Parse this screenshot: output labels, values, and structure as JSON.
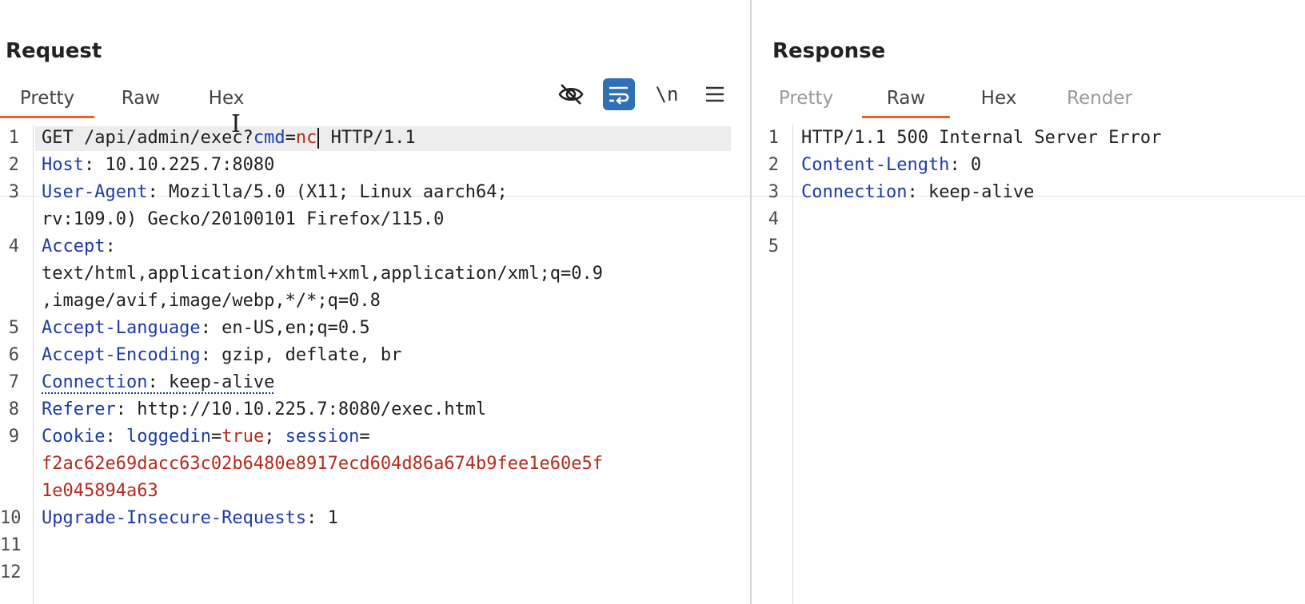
{
  "request": {
    "title": "Request",
    "tabs": [
      {
        "label": "Pretty",
        "active": true
      },
      {
        "label": "Raw",
        "active": false
      },
      {
        "label": "Hex",
        "active": false
      }
    ],
    "toolbar_icons": [
      {
        "name": "hide-nonprinting-icon"
      },
      {
        "name": "word-wrap-icon",
        "active": true
      },
      {
        "name": "newline-toggle-icon",
        "label": "\\n"
      },
      {
        "name": "menu-icon"
      }
    ],
    "line_numbers": [
      "1",
      "2",
      "3",
      "4",
      "5",
      "6",
      "7",
      "8",
      "9",
      "10",
      "11",
      "12"
    ],
    "lines": {
      "l1": {
        "method": "GET ",
        "path": "/api/admin/exec?",
        "param_name": "cmd",
        "eq": "=",
        "param_value": "nc",
        "protocol": " HTTP/1.1"
      },
      "l2": {
        "name": "Host",
        "value": ": 10.10.225.7:8080"
      },
      "l3": {
        "name": "User-Agent",
        "value": ": Mozilla/5.0 (X11; Linux aarch64;",
        "cont": "rv:109.0) Gecko/20100101 Firefox/115.0"
      },
      "l4": {
        "name": "Accept",
        "value": ":",
        "cont1": "text/html,application/xhtml+xml,application/xml;q=0.9",
        "cont2": ",image/avif,image/webp,*/*;q=0.8"
      },
      "l5": {
        "name": "Accept-Language",
        "value": ": en-US,en;q=0.5"
      },
      "l6": {
        "name": "Accept-Encoding",
        "value": ": gzip, deflate, br"
      },
      "l7": {
        "name": "Connection",
        "value": ": keep-alive"
      },
      "l8": {
        "name": "Referer",
        "value": ": http://10.10.225.7:8080/exec.html"
      },
      "l9": {
        "name": "Cookie",
        "sep": ": ",
        "c1_name": "loggedin",
        "c1_eq": "=",
        "c1_value": "true",
        "c_sep": "; ",
        "c2_name": "session",
        "c2_eq": "=",
        "c2_value1": "f2ac62e69dacc63c02b6480e8917ecd604d86a674b9fee1e60e5f",
        "c2_value2": "1e045894a63"
      },
      "l10": {
        "name": "Upgrade-Insecure-Requests",
        "value": ": 1"
      }
    }
  },
  "response": {
    "title": "Response",
    "tabs": [
      {
        "label": "Pretty",
        "active": false,
        "disabled": true
      },
      {
        "label": "Raw",
        "active": true
      },
      {
        "label": "Hex",
        "active": false
      },
      {
        "label": "Render",
        "active": false,
        "disabled": true
      }
    ],
    "line_numbers": [
      "1",
      "2",
      "3",
      "4",
      "5"
    ],
    "lines": {
      "l1": {
        "text": "HTTP/1.1 500 Internal Server Error"
      },
      "l2": {
        "name": "Content-Length",
        "value": ": 0"
      },
      "l3": {
        "name": "Connection",
        "value": ": keep-alive"
      }
    }
  },
  "colors": {
    "accent": "#e5612f",
    "header_name": "#1c3aa9",
    "cookie_value": "#b52a1d",
    "toggle_active": "#2f6fb6"
  }
}
